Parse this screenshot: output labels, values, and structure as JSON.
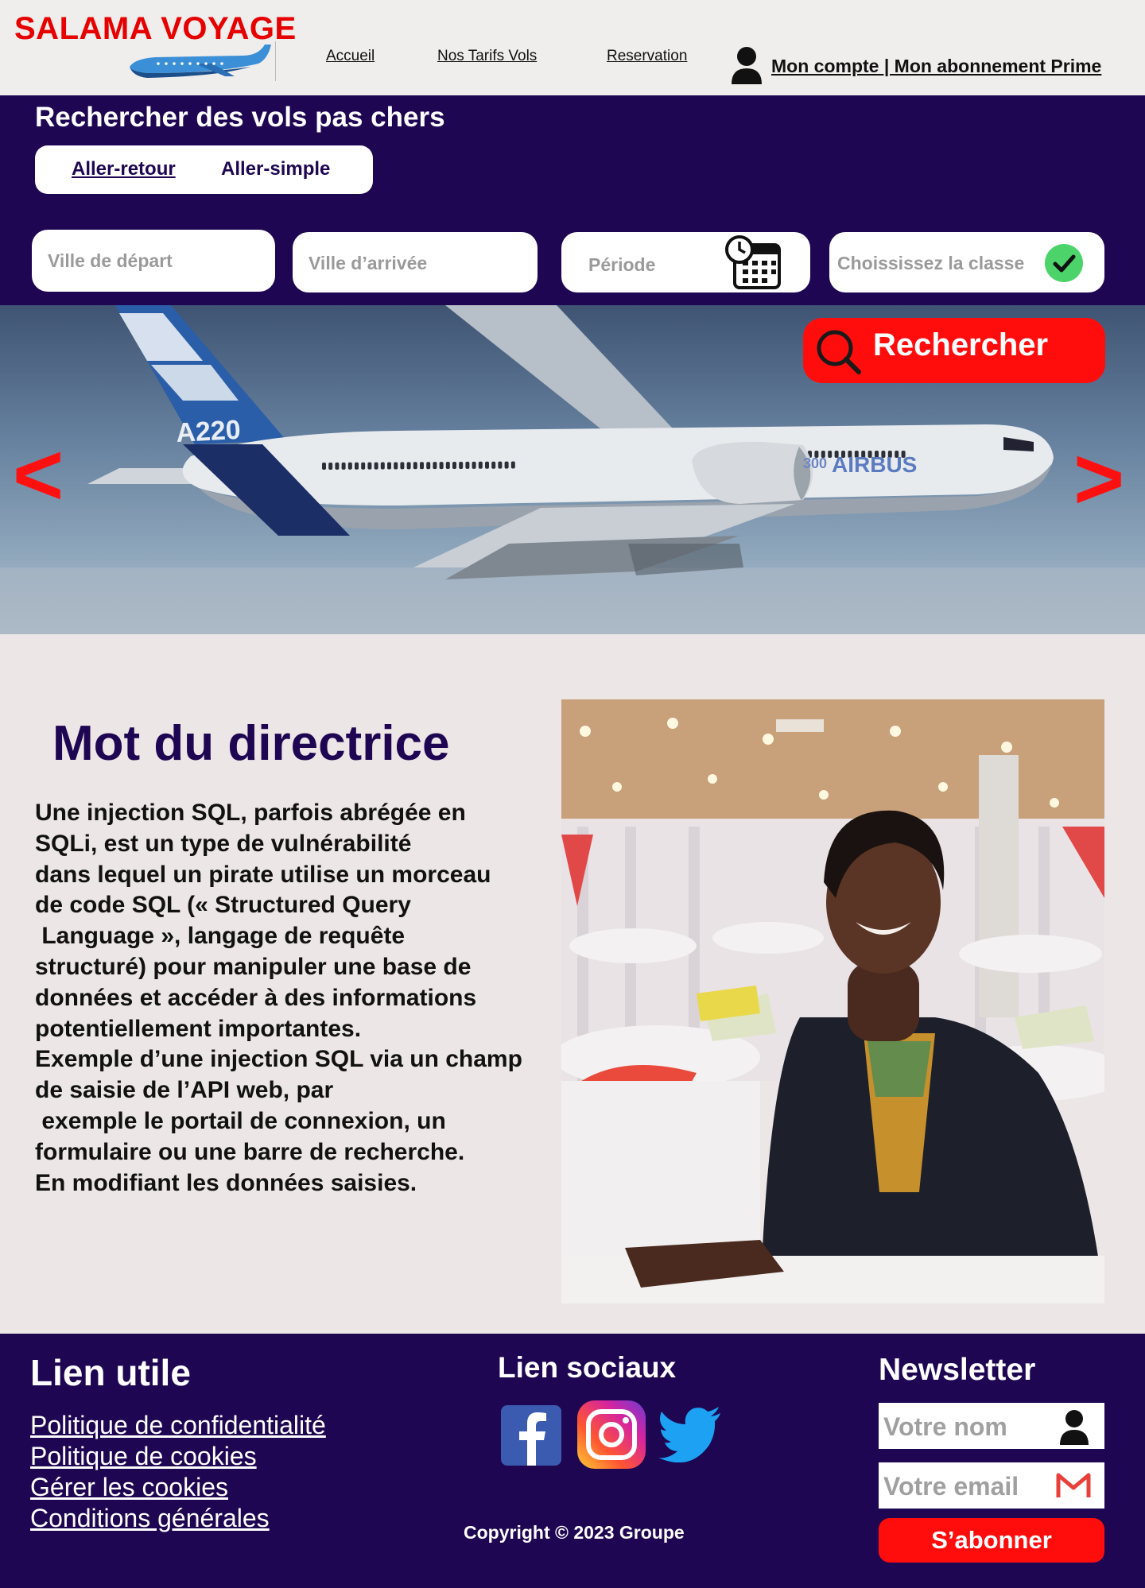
{
  "header": {
    "brand": "SALAMA VOYAGE",
    "nav": [
      "Accueil",
      "Nos Tarifs Vols",
      "Reservation"
    ],
    "account_label": "Mon compte | Mon abonnement Prime"
  },
  "search": {
    "title": "Rechercher des vols pas chers",
    "trip_types": [
      "Aller-retour",
      "Aller-simple"
    ],
    "fields": {
      "departure": "Ville de départ",
      "arrival": "Ville d’arrivée",
      "period": "Période",
      "class": "Choississez la classe"
    },
    "button": "Rechercher"
  },
  "hero": {
    "prev": "<",
    "next": ">",
    "plane_marks": [
      "A220",
      "300",
      "AIRBUS"
    ]
  },
  "about": {
    "title": "Mot du directrice",
    "lines": [
      "Une injection SQL, parfois abrégée en",
      "SQLi, est un type de vulnérabilité",
      "dans lequel un pirate utilise un morceau",
      "de code SQL (« Structured Query",
      " Language », langage de requête",
      "structuré) pour manipuler une base de",
      "données et accéder à des informations",
      "potentiellement importantes.",
      "Exemple d’une injection SQL via un champ",
      "de saisie de l’API web, par",
      " exemple le portail de connexion, un",
      "formulaire ou une barre de recherche.",
      "En modifiant les données saisies."
    ]
  },
  "footer": {
    "useful_title": "Lien utile",
    "useful_links": [
      "Politique de confidentialité",
      "Politique de cookies",
      "Gérer les cookies",
      "Conditions générales"
    ],
    "social_title": "Lien sociaux",
    "social_icons": [
      "facebook-icon",
      "instagram-icon",
      "twitter-icon"
    ],
    "copyright": "Copyright © 2023  Groupe",
    "newsletter_title": "Newsletter",
    "name_placeholder": "Votre nom",
    "email_placeholder": "Votre  email",
    "subscribe": "S’abonner"
  },
  "colors": {
    "brand_red": "#e60000",
    "navy": "#1e0652",
    "button_red": "#ff0d0d",
    "page_bg": "#ede6e6"
  }
}
